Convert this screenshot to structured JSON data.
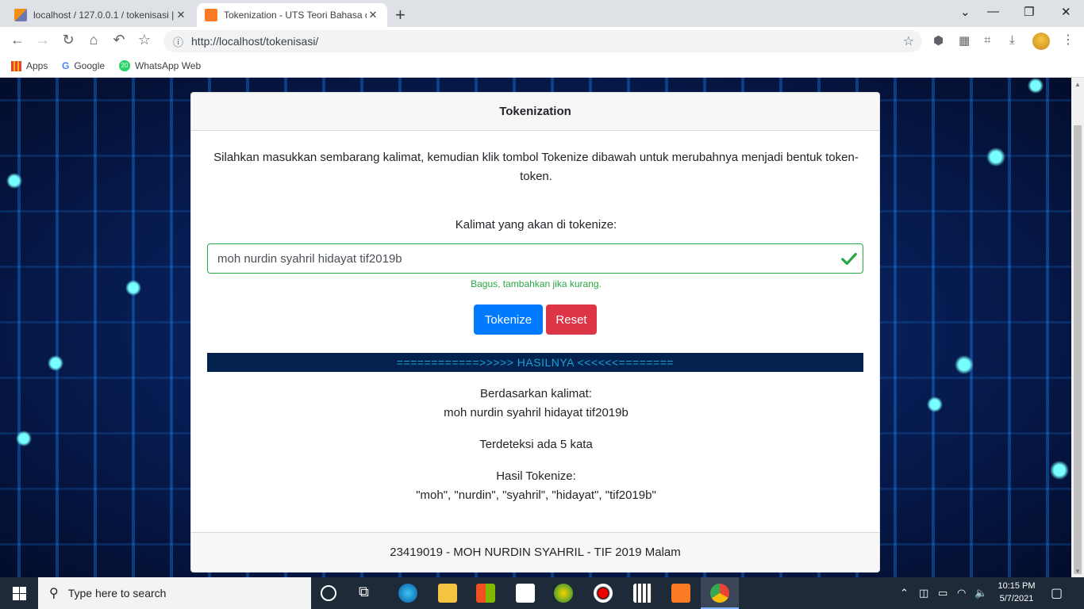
{
  "browser": {
    "tabs": [
      {
        "title": "localhost / 127.0.0.1 / tokenisasi |",
        "active": false
      },
      {
        "title": "Tokenization - UTS Teori Bahasa d",
        "active": true
      }
    ],
    "new_tab": "+",
    "window_controls": {
      "minimize": "—",
      "maximize": "❐",
      "close": "✕"
    },
    "url": "http://localhost/tokenisasi/",
    "bookmarks": [
      {
        "label": "Apps",
        "icon": "apps-grid-icon"
      },
      {
        "label": "Google",
        "icon": "google-icon"
      },
      {
        "label": "WhatsApp Web",
        "icon": "whatsapp-icon",
        "badge": "20"
      }
    ]
  },
  "page": {
    "header_title": "Tokenization",
    "intro": "Silahkan masukkan sembarang kalimat, kemudian klik tombol Tokenize dibawah untuk merubahnya menjadi bentuk token-token.",
    "input_label": "Kalimat yang akan di tokenize:",
    "input_value": "moh nurdin syahril hidayat tif2019b",
    "valid_feedback": "Bagus, tambahkan jika kurang.",
    "tokenize_button": "Tokenize",
    "reset_button": "Reset",
    "result_banner": "============>>>>> HASILNYA <<<<<<========",
    "based_on_label": "Berdasarkan kalimat:",
    "based_on_value": "moh nurdin syahril hidayat tif2019b",
    "word_count_text": "Terdeteksi ada 5 kata",
    "tokens_label": "Hasil Tokenize:",
    "tokens_value": "\"moh\", \"nurdin\", \"syahril\", \"hidayat\", \"tif2019b\"",
    "footer": "23419019 - MOH NURDIN SYAHRIL - TIF 2019 Malam"
  },
  "taskbar": {
    "search_placeholder": "Type here to search",
    "time": "10:15 PM",
    "date": "5/7/2021"
  },
  "colors": {
    "primary": "#007bff",
    "danger": "#dc3545",
    "success": "#28a745",
    "banner_bg": "#03224d",
    "banner_text": "#17a2d8"
  }
}
